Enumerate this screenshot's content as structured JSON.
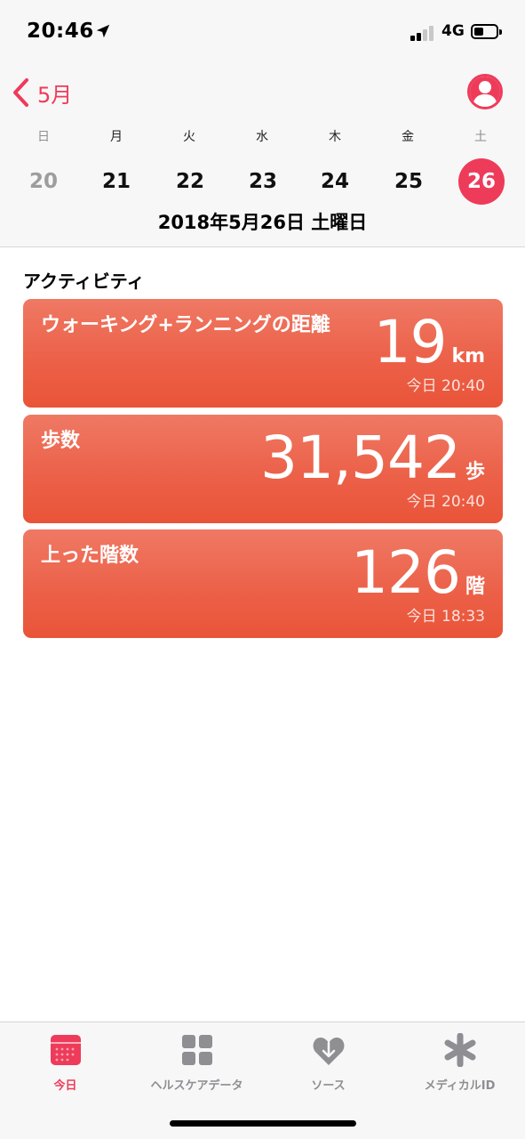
{
  "status_bar": {
    "time": "20:46",
    "network": "4G"
  },
  "nav": {
    "back_label": "5月"
  },
  "week": {
    "weekdays": [
      "日",
      "月",
      "火",
      "水",
      "木",
      "金",
      "土"
    ],
    "days": [
      "20",
      "21",
      "22",
      "23",
      "24",
      "25",
      "26"
    ],
    "selected_index": 6
  },
  "date_heading": "2018年5月26日 土曜日",
  "section_title": "アクティビティ",
  "cards": [
    {
      "title": "ウォーキング+ランニングの距離",
      "value": "19",
      "unit": "km",
      "time": "今日 20:40"
    },
    {
      "title": "歩数",
      "value": "31,542",
      "unit": "歩",
      "time": "今日 20:40"
    },
    {
      "title": "上った階数",
      "value": "126",
      "unit": "階",
      "time": "今日 18:33"
    }
  ],
  "tabs": [
    {
      "label": "今日",
      "icon": "calendar-icon",
      "active": true
    },
    {
      "label": "ヘルスケアデータ",
      "icon": "grid-icon",
      "active": false
    },
    {
      "label": "ソース",
      "icon": "heart-download-icon",
      "active": false
    },
    {
      "label": "メディカルID",
      "icon": "asterisk-icon",
      "active": false
    }
  ],
  "colors": {
    "accent": "#ee3b5a",
    "card": "#ec6149",
    "inactive": "#8e8e93"
  }
}
